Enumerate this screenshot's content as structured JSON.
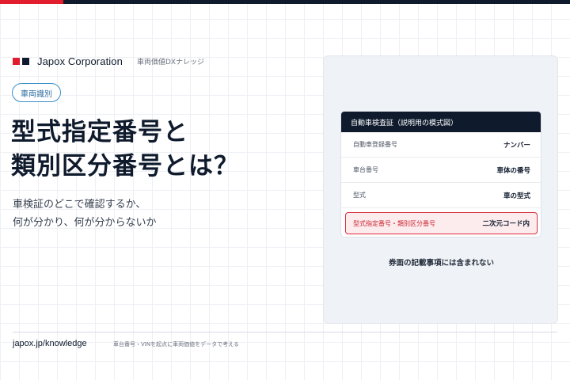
{
  "brand": {
    "name": "Japox Corporation",
    "subtitle": "車両価値DXナレッジ"
  },
  "tag": "車両識別",
  "headline": {
    "line1": "型式指定番号と",
    "line2": "類別区分番号とは？"
  },
  "description": {
    "line1": "車検証のどこで確認するか、",
    "line2": "何が分かり、何が分からないか"
  },
  "card": {
    "title": "自動車検査証（説明用の模式図）",
    "rows": [
      {
        "label": "自動車登録番号",
        "value": "ナンバー"
      },
      {
        "label": "車台番号",
        "value": "車体の番号"
      },
      {
        "label": "型式",
        "value": "車の型式"
      },
      {
        "label": "型式指定番号・類別区分番号",
        "value": "二次元コード内"
      }
    ],
    "note": "券面の記載事項には含まれない"
  },
  "footer": {
    "url": "japox.jp/knowledge",
    "tagline": "車台番号・VINを起点に車両価値をデータで考える"
  },
  "colors": {
    "navy": "#0f1b2d",
    "red": "#e11d2e",
    "chip_blue": "#3b8ec9",
    "panel_bg": "#eff2f6",
    "highlight_bg": "#fdecee"
  }
}
